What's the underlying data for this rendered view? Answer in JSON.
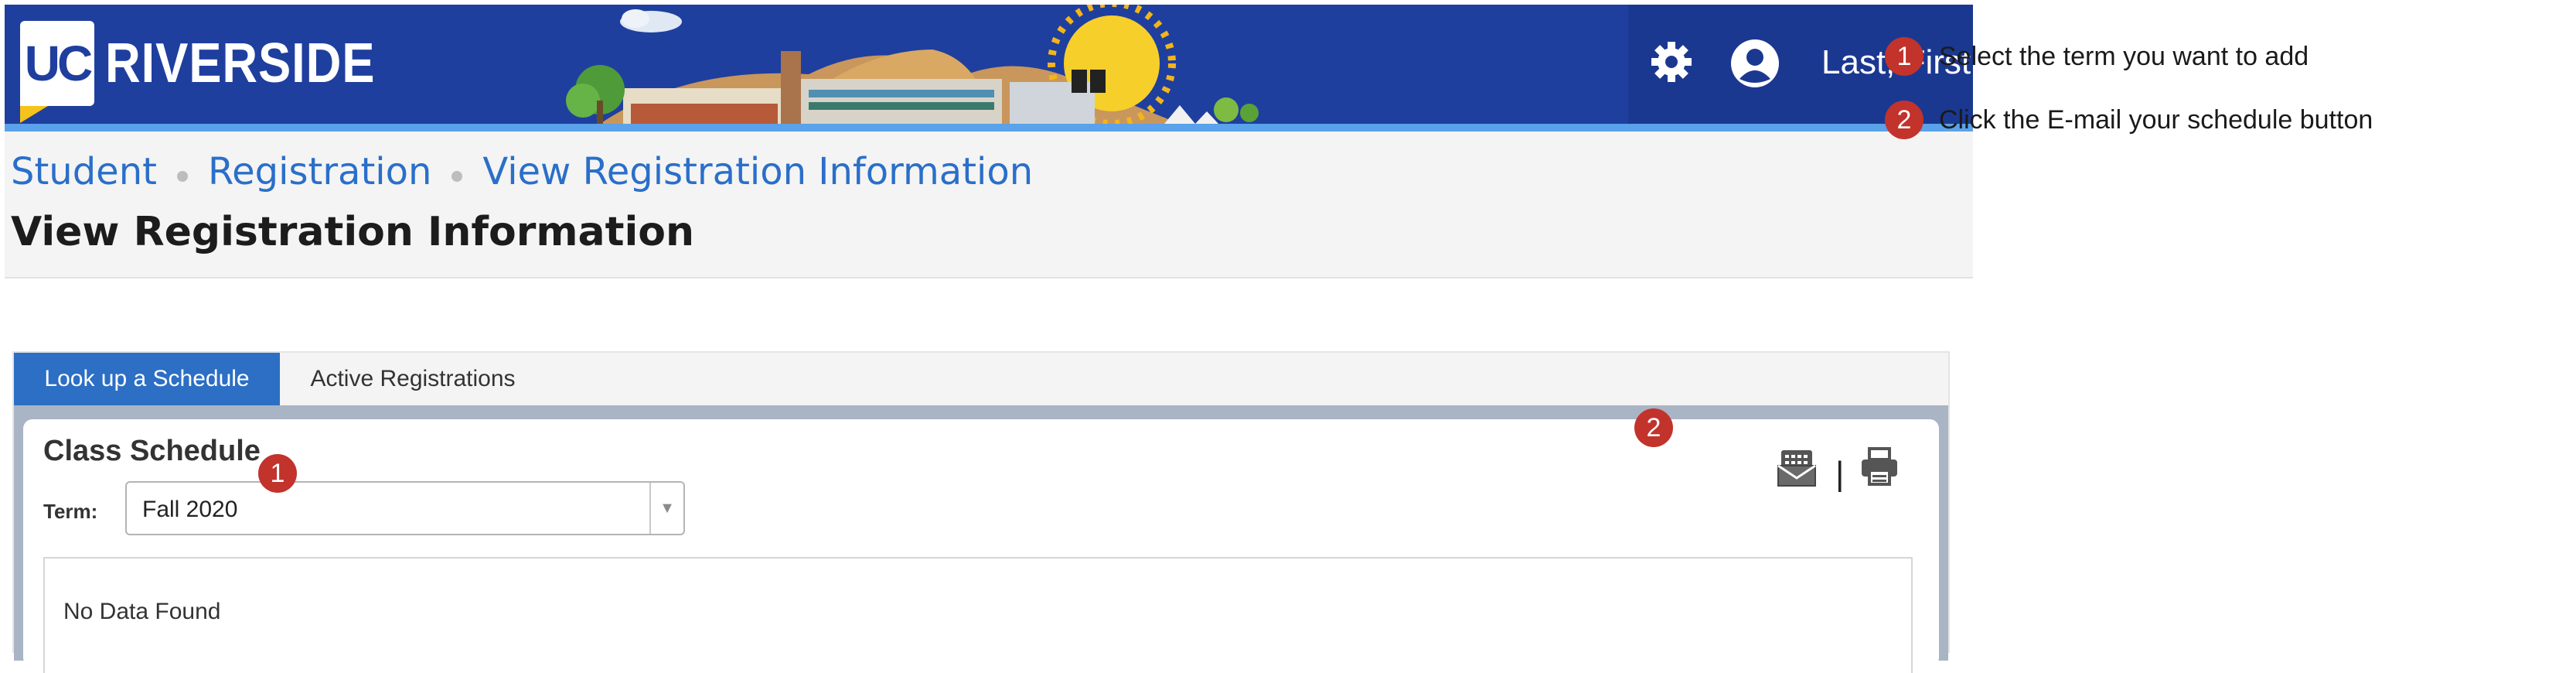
{
  "header": {
    "logo_uc": "UC",
    "logo_name": "RIVERSIDE",
    "user_name": "Last, First"
  },
  "breadcrumb": [
    "Student",
    "Registration",
    "View Registration Information"
  ],
  "page_title": "View Registration Information",
  "tabs": [
    {
      "label": "Look up a Schedule",
      "active": true
    },
    {
      "label": "Active Registrations",
      "active": false
    }
  ],
  "panel": {
    "title": "Class Schedule",
    "term_label": "Term:",
    "term_value": "Fall 2020",
    "separator": "|",
    "no_data": "No Data Found"
  },
  "callouts": [
    {
      "number": "1",
      "text": "Select the term you want to add"
    },
    {
      "number": "2",
      "text": "Click the E-mail your schedule button"
    }
  ],
  "colors": {
    "header_bg": "#1f3f9f",
    "accent": "#5aa2ea",
    "link": "#2a6fc9",
    "tab_active": "#2c6fc4",
    "callout": "#c2332c"
  }
}
